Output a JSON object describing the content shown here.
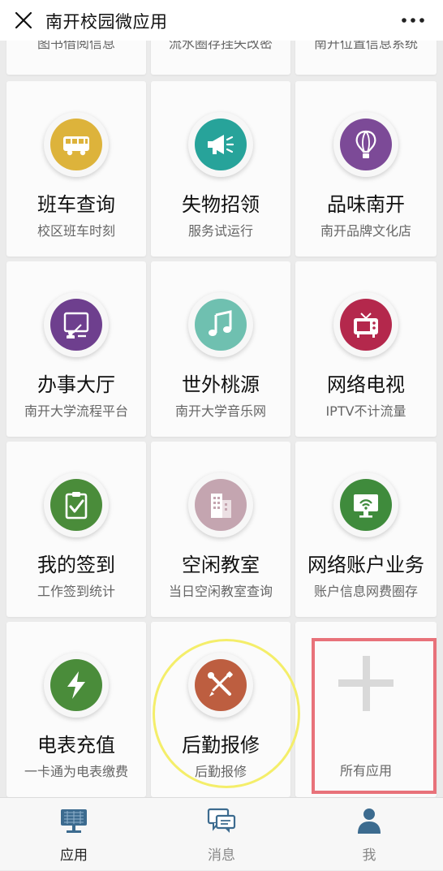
{
  "header": {
    "title": "南开校园微应用"
  },
  "partial_row": [
    "图书借阅信息",
    "流水圈存挂失改密",
    "南开位置信息系统"
  ],
  "apps": [
    {
      "title": "班车查询",
      "subtitle": "校区班车时刻",
      "icon": "bus-icon",
      "color": "#ddb33b"
    },
    {
      "title": "失物招领",
      "subtitle": "服务试运行",
      "icon": "megaphone-icon",
      "color": "#27a39a"
    },
    {
      "title": "品味南开",
      "subtitle": "南开品牌文化店",
      "icon": "hot-air-balloon-icon",
      "color": "#7c4a97"
    },
    {
      "title": "办事大厅",
      "subtitle": "南开大学流程平台",
      "icon": "presentation-board-icon",
      "color": "#6e3f8e"
    },
    {
      "title": "世外桃源",
      "subtitle": "南开大学音乐网",
      "icon": "music-note-icon",
      "color": "#6fc0b0"
    },
    {
      "title": "网络电视",
      "subtitle": "IPTV不计流量",
      "icon": "tv-icon",
      "color": "#b4284c"
    },
    {
      "title": "我的签到",
      "subtitle": "工作签到统计",
      "icon": "clipboard-check-icon",
      "color": "#4a8c3a"
    },
    {
      "title": "空闲教室",
      "subtitle": "当日空闲教室查询",
      "icon": "building-icon",
      "color": "#c4a5b0"
    },
    {
      "title": "网络账户业务",
      "subtitle": "账户信息网费圈存",
      "icon": "monitor-wifi-icon",
      "color": "#3f8b3c"
    },
    {
      "title": "电表充值",
      "subtitle": "一卡通为电表缴费",
      "icon": "lightning-icon",
      "color": "#4a8c3a"
    },
    {
      "title": "后勤报修",
      "subtitle": "后勤报修",
      "icon": "wrench-screwdriver-icon",
      "color": "#bd5e40"
    }
  ],
  "all_apps": {
    "subtitle": "所有应用",
    "icon": "plus-icon"
  },
  "tabs": [
    {
      "label": "应用",
      "icon": "apps-board-icon",
      "active": true
    },
    {
      "label": "消息",
      "icon": "message-icon",
      "active": false
    },
    {
      "label": "我",
      "icon": "person-icon",
      "active": false
    }
  ],
  "colors": {
    "highlight_circle": "#f4ee6a",
    "highlight_rect": "#e8727a",
    "accent": "#3c6b8f"
  }
}
